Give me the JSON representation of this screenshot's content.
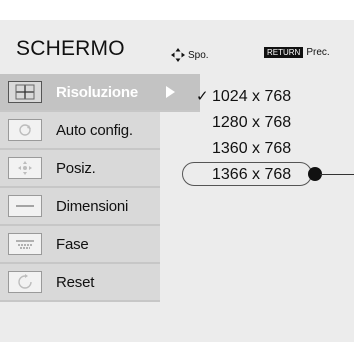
{
  "header": {
    "title": "SCHERMO",
    "move_hint": "Spo.",
    "return_key": "RETURN",
    "return_hint": "Prec."
  },
  "menu": {
    "items": [
      {
        "label": "Risoluzione",
        "icon": "resolution-icon",
        "active": true
      },
      {
        "label": "Auto config.",
        "icon": "auto-config-icon",
        "active": false
      },
      {
        "label": "Posiz.",
        "icon": "position-icon",
        "active": false
      },
      {
        "label": "Dimensioni",
        "icon": "size-icon",
        "active": false
      },
      {
        "label": "Fase",
        "icon": "phase-icon",
        "active": false
      },
      {
        "label": "Reset",
        "icon": "reset-icon",
        "active": false
      }
    ]
  },
  "resolution_options": {
    "check_mark": "✓",
    "items": [
      {
        "label": "1024 x 768",
        "checked": true
      },
      {
        "label": "1280 x 768",
        "checked": false
      },
      {
        "label": "1360 x 768",
        "checked": false
      },
      {
        "label": "1366 x 768",
        "checked": false,
        "highlighted": true
      }
    ]
  },
  "colors": {
    "panel_bg": "#ececec",
    "menu_item_bg": "#d9d9d9",
    "active_item_bg": "#c3c3c3",
    "text": "#111111",
    "active_text": "#ffffff"
  }
}
